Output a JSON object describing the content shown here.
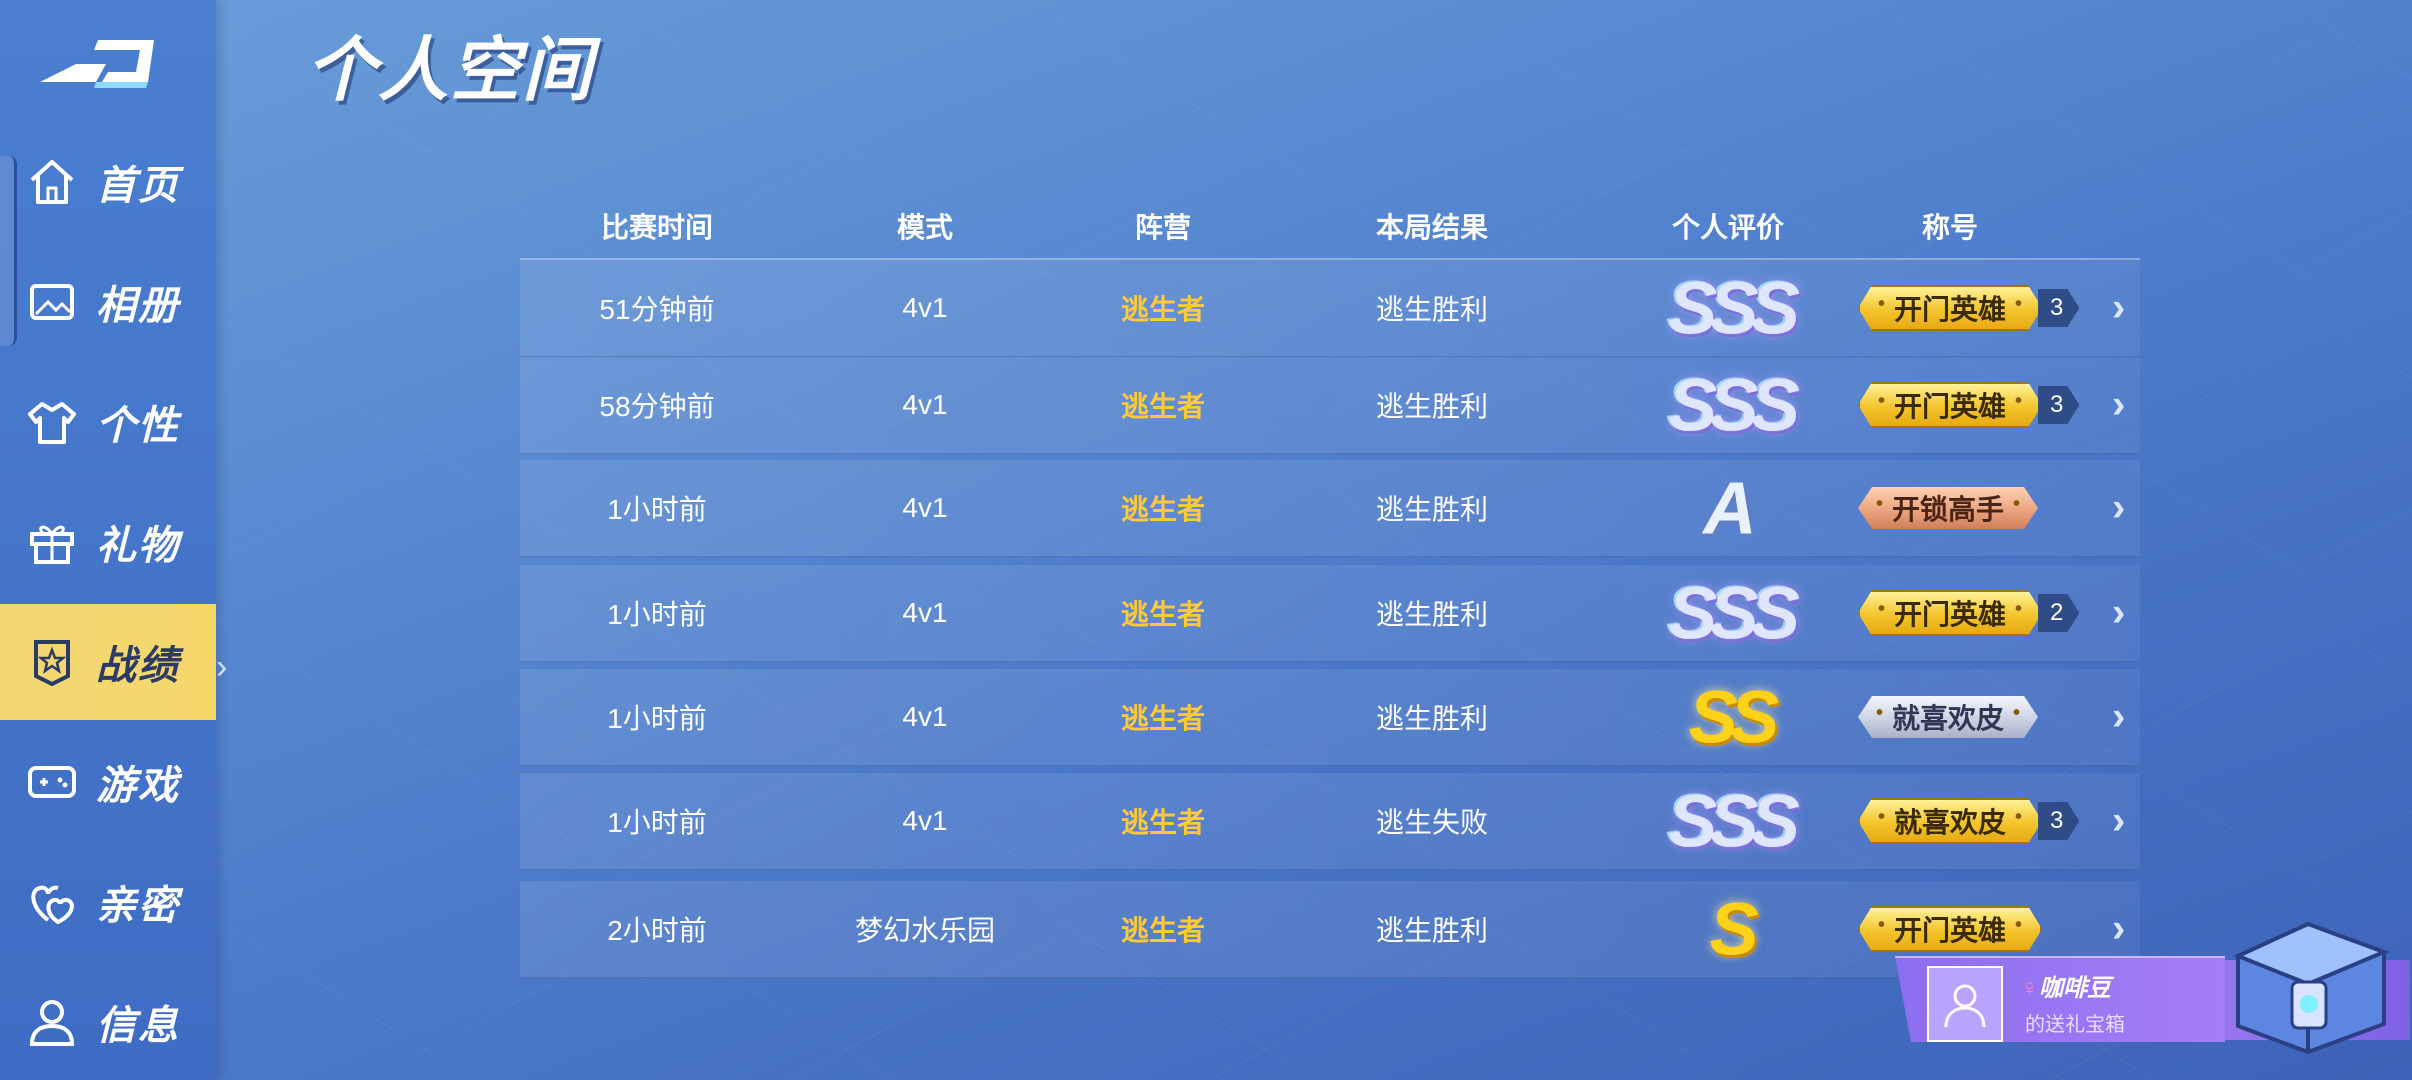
{
  "page": {
    "title": "个人空间"
  },
  "sidebar": {
    "items": [
      {
        "label": "首页",
        "icon": "home-icon"
      },
      {
        "label": "相册",
        "icon": "photo-icon"
      },
      {
        "label": "个性",
        "icon": "shirt-icon"
      },
      {
        "label": "礼物",
        "icon": "gift-icon"
      },
      {
        "label": "战绩",
        "icon": "badge-icon",
        "active": true
      },
      {
        "label": "游戏",
        "icon": "gamepad-icon"
      },
      {
        "label": "亲密",
        "icon": "hearts-icon"
      },
      {
        "label": "信息",
        "icon": "user-icon"
      }
    ]
  },
  "table": {
    "headers": [
      "比赛时间",
      "模式",
      "阵营",
      "本局结果",
      "个人评价",
      "称号"
    ],
    "rows": [
      {
        "time": "51分钟前",
        "mode": "4v1",
        "camp": "逃生者",
        "result": "逃生胜利",
        "rating": "SSS",
        "title": "开门英雄",
        "count": "3",
        "title_style": "gold"
      },
      {
        "time": "58分钟前",
        "mode": "4v1",
        "camp": "逃生者",
        "result": "逃生胜利",
        "rating": "SSS",
        "title": "开门英雄",
        "count": "3",
        "title_style": "gold"
      },
      {
        "time": "1小时前",
        "mode": "4v1",
        "camp": "逃生者",
        "result": "逃生胜利",
        "rating": "A",
        "title": "开锁高手",
        "count": "",
        "title_style": "bronze"
      },
      {
        "time": "1小时前",
        "mode": "4v1",
        "camp": "逃生者",
        "result": "逃生胜利",
        "rating": "SSS",
        "title": "开门英雄",
        "count": "2",
        "title_style": "gold"
      },
      {
        "time": "1小时前",
        "mode": "4v1",
        "camp": "逃生者",
        "result": "逃生胜利",
        "rating": "SS",
        "title": "就喜欢皮",
        "count": "",
        "title_style": "silver"
      },
      {
        "time": "1小时前",
        "mode": "4v1",
        "camp": "逃生者",
        "result": "逃生失败",
        "rating": "SSS",
        "title": "就喜欢皮",
        "count": "3",
        "title_style": "gold"
      },
      {
        "time": "2小时前",
        "mode": "梦幻水乐园",
        "camp": "逃生者",
        "result": "逃生胜利",
        "rating": "S",
        "title": "开门英雄",
        "count": "",
        "title_style": "gold"
      }
    ]
  },
  "gift_banner": {
    "name": "咖啡豆",
    "subtitle": "的送礼宝箱"
  },
  "colors": {
    "camp": "#ffc93a",
    "active_nav": "#f5d76a",
    "background": "#4a77c8"
  }
}
